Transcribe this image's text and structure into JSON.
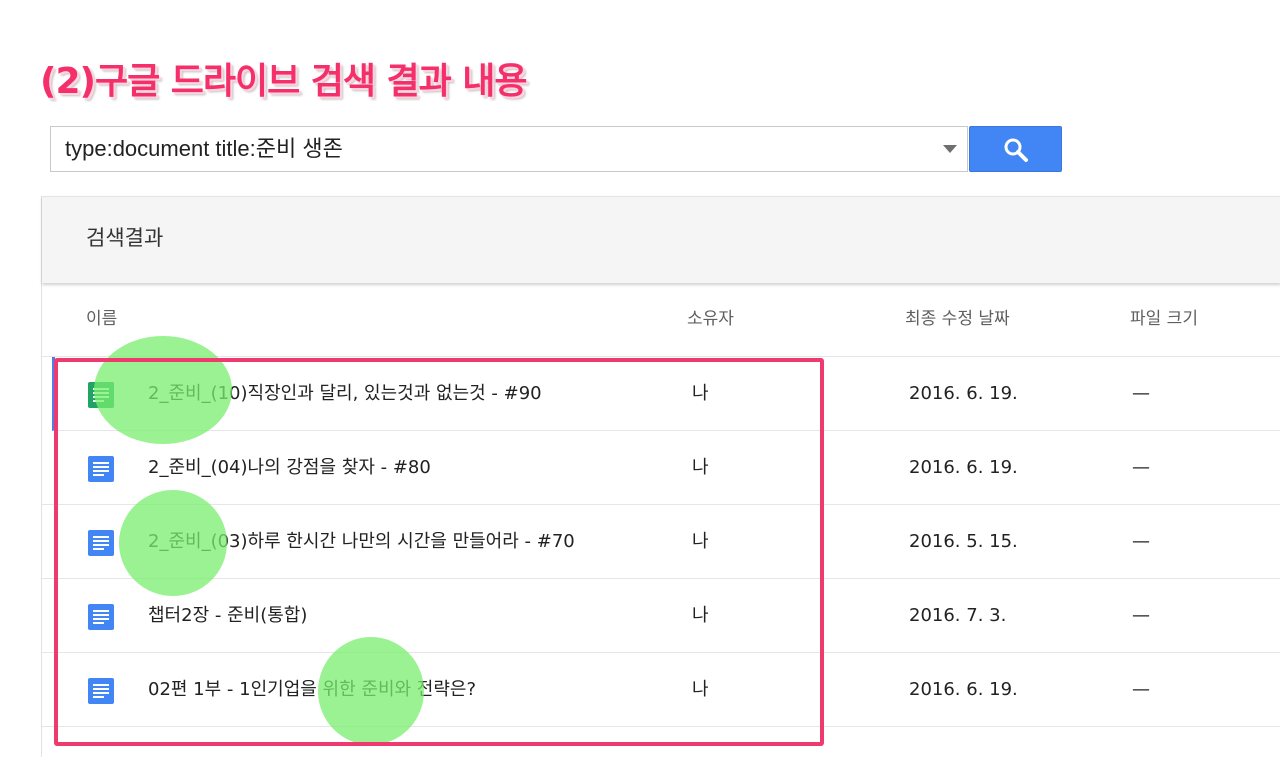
{
  "headline": "(2)구글 드라이브 검색 결과 내용",
  "search": {
    "query": "type:document title:준비 생존",
    "button_icon": "search-icon"
  },
  "results": {
    "title": "검색결과",
    "columns": {
      "name": "이름",
      "owner": "소유자",
      "modified": "최종 수정 날짜",
      "size": "파일 크기"
    },
    "rows": [
      {
        "name": "2_준비_(10)직장인과 달리, 있는것과 없는것 - #90",
        "owner": "나",
        "date": "2016. 6. 19.",
        "size": "—",
        "icon": "doc-icon"
      },
      {
        "name": "2_준비_(04)나의 강점을 찾자 - #80",
        "owner": "나",
        "date": "2016. 6. 19.",
        "size": "—",
        "icon": "doc-icon"
      },
      {
        "name": "2_준비_(03)하루 한시간 나만의 시간을 만들어라 - #70",
        "owner": "나",
        "date": "2016. 5. 15.",
        "size": "—",
        "icon": "doc-icon"
      },
      {
        "name": "챕터2장 - 준비(통합)",
        "owner": "나",
        "date": "2016. 7. 3.",
        "size": "—",
        "icon": "doc-icon"
      },
      {
        "name": "02편 1부 - 1인기업을 위한 준비와 전략은?",
        "owner": "나",
        "date": "2016. 6. 19.",
        "size": "—",
        "icon": "doc-icon"
      }
    ]
  },
  "colors": {
    "headline": "#f4306a",
    "search_button": "#4285f4",
    "annotation_box": "#ee3a6e",
    "highlight": "#78ee6e",
    "doc_icon": "#4285f4",
    "doc_icon_selected": "#1fa463"
  }
}
